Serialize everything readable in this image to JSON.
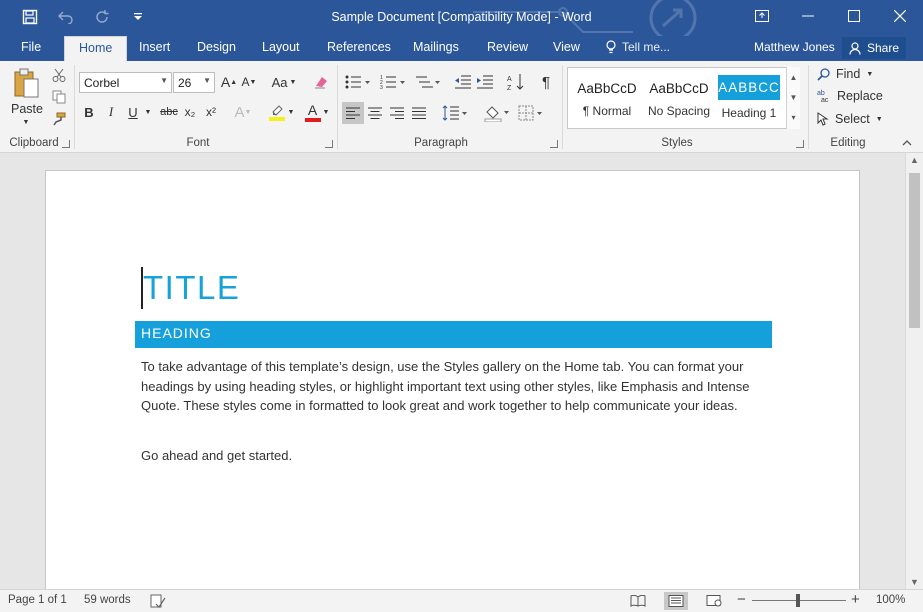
{
  "window": {
    "title": "Sample Document [Compatibility Mode] - Word"
  },
  "quick_access": {
    "save_icon": "save-icon",
    "undo_icon": "undo-icon",
    "redo_icon": "redo-icon",
    "customize_icon": "customize-qat-icon"
  },
  "tabs": {
    "file": "File",
    "home": "Home",
    "insert": "Insert",
    "design": "Design",
    "layout": "Layout",
    "references": "References",
    "mailings": "Mailings",
    "review": "Review",
    "view": "View"
  },
  "tell_me": "Tell me...",
  "user": {
    "name": "Matthew Jones",
    "share": "Share"
  },
  "ribbon": {
    "clipboard": {
      "label": "Clipboard",
      "paste": "Paste"
    },
    "font": {
      "label": "Font",
      "name": "Corbel",
      "size": "26",
      "bold": "B",
      "italic": "I",
      "underline": "U",
      "strikethrough": "abc",
      "subscript": "x₂",
      "superscript": "x²",
      "grow": "A",
      "shrink": "A",
      "change_case": "Aa",
      "font_color": "A",
      "text_effects": "A"
    },
    "paragraph": {
      "label": "Paragraph"
    },
    "styles": {
      "label": "Styles",
      "items": [
        {
          "preview": "AaBbCcD",
          "name": "¶ Normal"
        },
        {
          "preview": "AaBbCcD",
          "name": "No Spacing"
        },
        {
          "preview": "AABBCC",
          "name": "Heading 1"
        }
      ]
    },
    "editing": {
      "label": "Editing",
      "find": "Find",
      "replace": "Replace",
      "select": "Select"
    }
  },
  "document": {
    "title": "TITLE",
    "heading": "HEADING",
    "paragraph1": "To take advantage of this template’s design, use the Styles gallery on the Home tab. You can format your headings by using heading styles, or highlight important text using other styles, like Emphasis and Intense Quote. These styles come in formatted to look great and work together to help communicate your ideas.",
    "paragraph2": "Go ahead and get started."
  },
  "status": {
    "page": "Page 1 of 1",
    "words": "59 words",
    "zoom": "100%",
    "zoom_minus": "−",
    "zoom_plus": "+",
    "zoom_level": 1.0
  },
  "colors": {
    "accent": "#2b579a",
    "heading_fill": "#16a0db",
    "title_text": "#17a2d8"
  }
}
